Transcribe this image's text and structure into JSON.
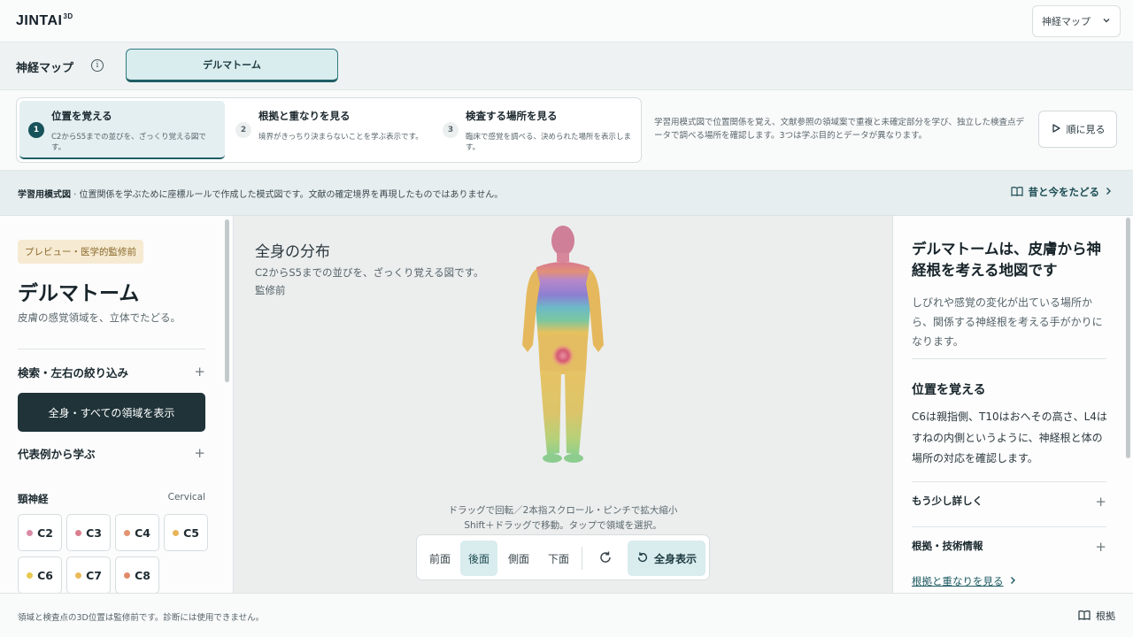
{
  "header": {
    "logo": "JINTAI",
    "logo_sup": "3D",
    "select_value": "神経マップ"
  },
  "module": {
    "title": "神経マップ",
    "tab_label": "デルマトーム"
  },
  "steps": [
    {
      "num": "1",
      "title": "位置を覚える",
      "desc": "C2からS5までの並びを、ざっくり覚える図です。",
      "active": true
    },
    {
      "num": "2",
      "title": "根拠と重なりを見る",
      "desc": "境界がきっちり決まらないことを学ぶ表示です。",
      "active": false
    },
    {
      "num": "3",
      "title": "検査する場所を見る",
      "desc": "臨床で感覚を調べる、決められた場所を表示します。",
      "active": false
    }
  ],
  "steps_note": "学習用模式図で位置関係を覚え、文献参照の領域案で重複と未確定部分を学び、独立した検査点データで調べる場所を確認します。3つは学ぶ目的とデータが異なります。",
  "order_button": "順に見る",
  "notice": {
    "bold": "学習用模式図",
    "text": " · 位置関係を学ぶために座標ルールで作成した模式図です。文献の確定境界を再現したものではありません。",
    "link": "昔と今をたどる"
  },
  "left": {
    "badge": "プレビュー・医学的監修前",
    "title": "デルマトーム",
    "subtitle": "皮膚の感覚領域を、立体でたどる。",
    "search_section": "検索・左右の絞り込み",
    "show_all_button": "全身・すべての領域を表示",
    "examples_section": "代表例から学ぶ",
    "group_title": "頸神経",
    "group_en": "Cervical",
    "chips": [
      {
        "label": "C2",
        "color": "#d98aa6"
      },
      {
        "label": "C3",
        "color": "#d97f8f"
      },
      {
        "label": "C4",
        "color": "#e3936f"
      },
      {
        "label": "C5",
        "color": "#e8b45a"
      },
      {
        "label": "C6",
        "color": "#e8c84f"
      },
      {
        "label": "C7",
        "color": "#eab95a"
      },
      {
        "label": "C8",
        "color": "#e08a6a"
      }
    ]
  },
  "center": {
    "title": "全身の分布",
    "subtitle": "C2からS5までの並びを、ざっくり覚える図です。",
    "status": "監修前",
    "hint1": "ドラッグで回転／2本指スクロール・ピンチで拡大縮小",
    "hint2": "Shift＋ドラッグで移動。タップで領域を選択。",
    "views": [
      "前面",
      "後面",
      "側面",
      "下面"
    ],
    "selected_view": "後面",
    "full_view": "全身表示"
  },
  "right": {
    "heading": "デルマトームは、皮膚から神経根を考える地図です",
    "intro": "しびれや感覚の変化が出ている場所から、関係する神経根を考える手がかりになります。",
    "section_title": "位置を覚える",
    "section_text": "C6は親指側、T10はおへその高さ、L4はすねの内側というように、神経根と体の場所の対応を確認します。",
    "more": "もう少し詳しく",
    "tech": "根拠・技術情報",
    "next_link": "根拠と重なりを見る"
  },
  "footer": {
    "text": "領域と検査点の3D位置は監修前です。診断には使用できません。",
    "link": "根拠"
  }
}
